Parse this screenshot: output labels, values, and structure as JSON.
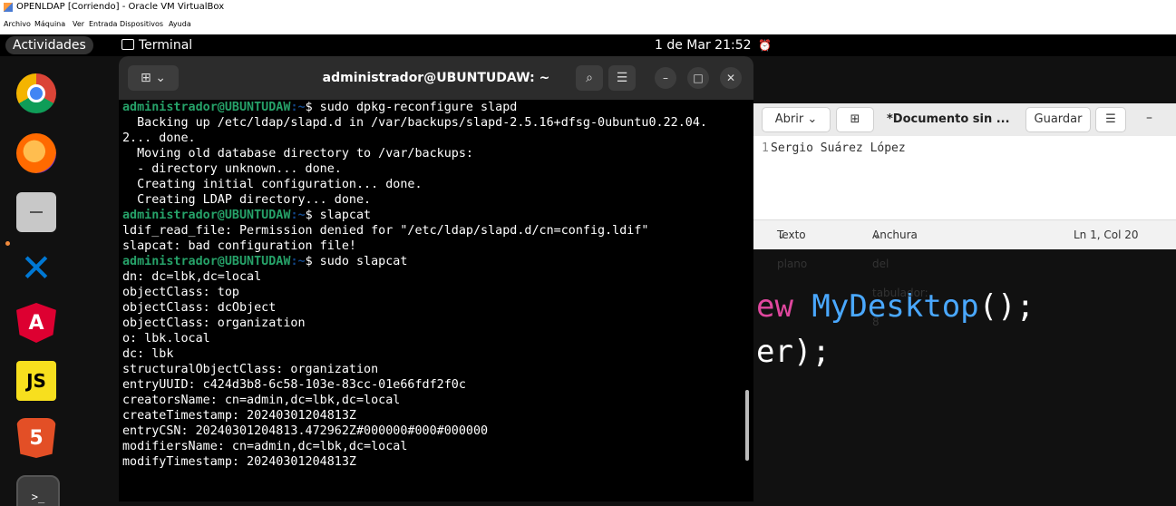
{
  "vbox": {
    "title": "OPENLDAP [Corriendo] - Oracle VM VirtualBox",
    "menu": [
      "Archivo",
      "Máquina",
      "Ver",
      "Entrada",
      "Dispositivos",
      "Ayuda"
    ]
  },
  "topbar": {
    "activities": "Actividades",
    "app": "Terminal",
    "clock": "1 de Mar  21:52"
  },
  "dock": {
    "items": [
      "chrome-icon",
      "firefox-icon",
      "files-icon",
      "vscode-icon",
      "angular-icon",
      "javascript-icon",
      "html5-icon",
      "terminal-icon"
    ],
    "labels": {
      "angular": "A",
      "js": "JS",
      "html5": "5",
      "term": ">_"
    }
  },
  "terminal": {
    "title": "administrador@UBUNTUDAW: ~",
    "prompt_user": "administrador@UBUNTUDAW",
    "prompt_path": ":~",
    "lines": [
      {
        "prompt": true,
        "cmd": "$ sudo dpkg-reconfigure slapd"
      },
      {
        "text": "  Backing up /etc/ldap/slapd.d in /var/backups/slapd-2.5.16+dfsg-0ubuntu0.22.04."
      },
      {
        "text": "2... done."
      },
      {
        "text": "  Moving old database directory to /var/backups:"
      },
      {
        "text": "  - directory unknown... done."
      },
      {
        "text": "  Creating initial configuration... done."
      },
      {
        "text": "  Creating LDAP directory... done."
      },
      {
        "prompt": true,
        "cmd": "$ slapcat"
      },
      {
        "text": "ldif_read_file: Permission denied for \"/etc/ldap/slapd.d/cn=config.ldif\""
      },
      {
        "text": "slapcat: bad configuration file!"
      },
      {
        "prompt": true,
        "cmd": "$ sudo slapcat"
      },
      {
        "text": "dn: dc=lbk,dc=local"
      },
      {
        "text": "objectClass: top"
      },
      {
        "text": "objectClass: dcObject"
      },
      {
        "text": "objectClass: organization"
      },
      {
        "text": "o: lbk.local"
      },
      {
        "text": "dc: lbk"
      },
      {
        "text": "structuralObjectClass: organization"
      },
      {
        "text": "entryUUID: c424d3b8-6c58-103e-83cc-01e66fdf2f0c"
      },
      {
        "text": "creatorsName: cn=admin,dc=lbk,dc=local"
      },
      {
        "text": "createTimestamp: 20240301204813Z"
      },
      {
        "text": "entryCSN: 20240301204813.472962Z#000000#000#000000"
      },
      {
        "text": "modifiersName: cn=admin,dc=lbk,dc=local"
      },
      {
        "text": "modifyTimestamp: 20240301204813Z"
      }
    ]
  },
  "gedit": {
    "open_label": "Abrir",
    "doc_title": "*Documento sin ...",
    "save_label": "Guardar",
    "line_number": "1",
    "line_text": "Sergio Suárez López",
    "status_mode": "Texto plano",
    "status_tab": "Anchura del tabulador: 8",
    "status_pos": "Ln 1, Col 20"
  },
  "background_code": {
    "line1_part1": "ew ",
    "line1_part2": "MyDesktop",
    "line1_part3": "();",
    "line2": "er);",
    "brace": "}"
  }
}
